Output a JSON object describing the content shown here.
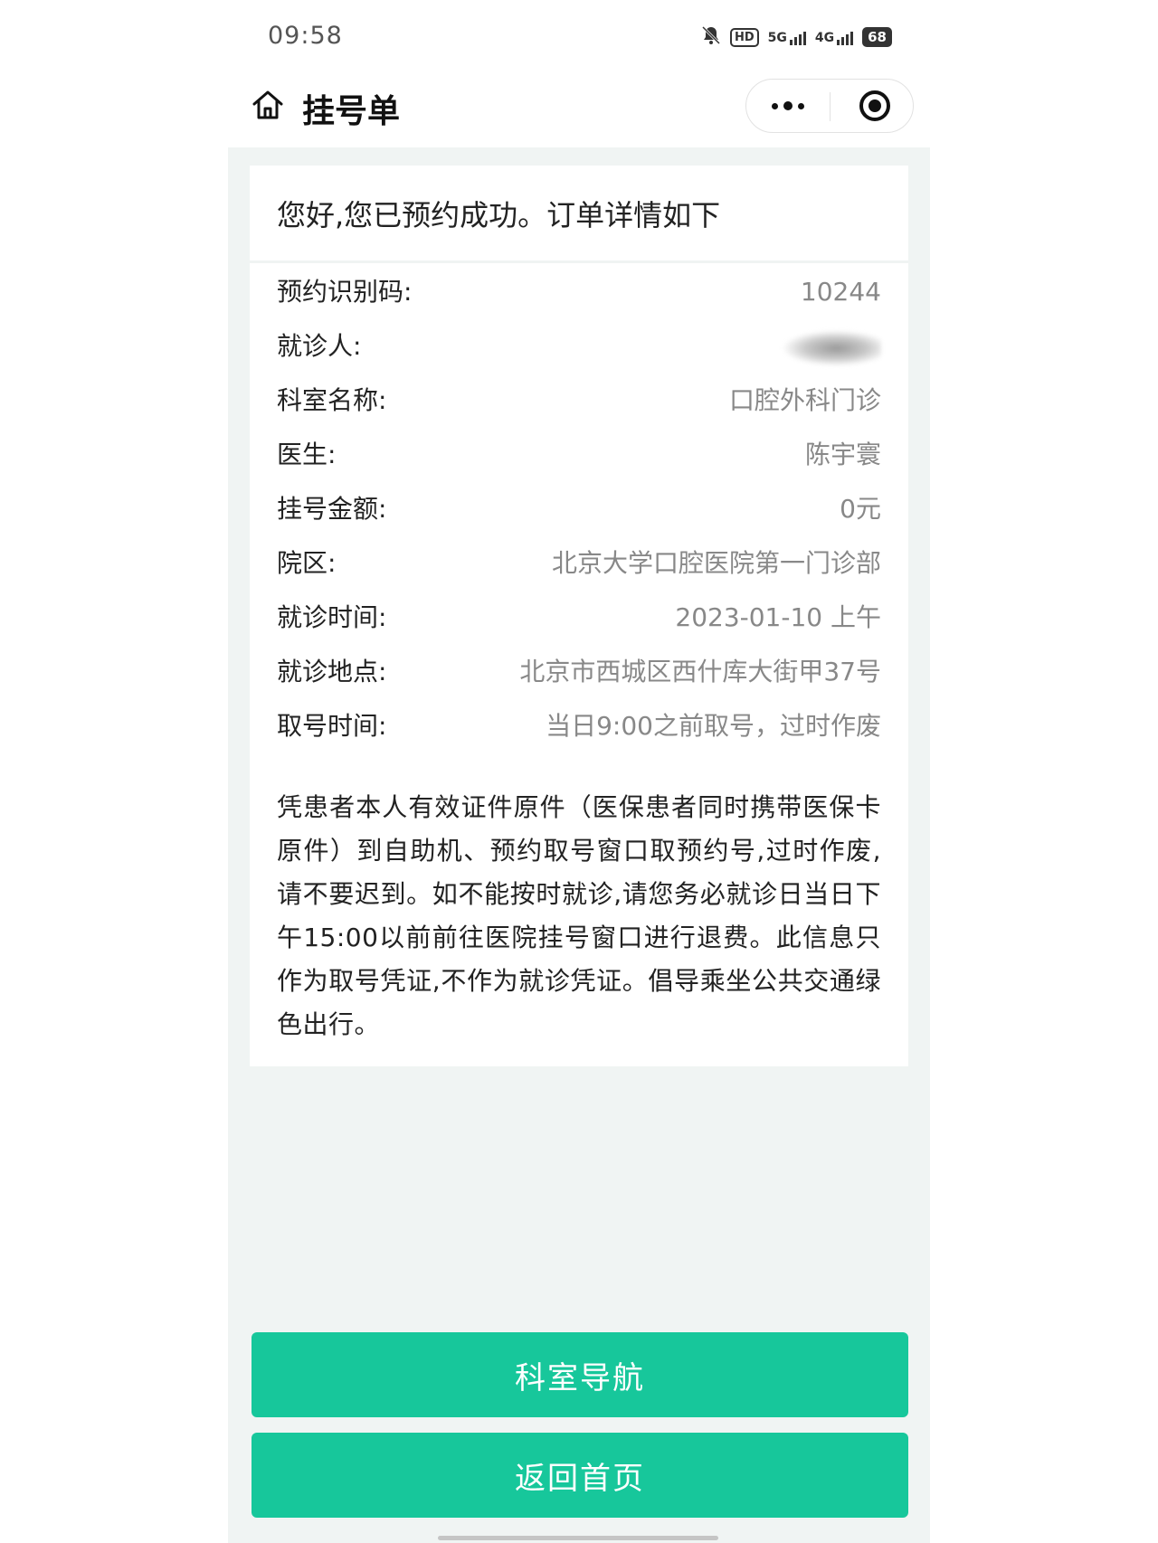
{
  "status_bar": {
    "time": "09:58",
    "hd_label": "HD",
    "net1": "5G",
    "net2": "4G",
    "battery": "68"
  },
  "header": {
    "title": "挂号单",
    "home_icon": "home-icon",
    "more_icon": "more-icon",
    "close_icon": "target-close-icon"
  },
  "card": {
    "greeting": "您好,您已预约成功。订单详情如下",
    "rows": [
      {
        "label": "预约识别码:",
        "value": "10244"
      },
      {
        "label": "就诊人:",
        "value": ""
      },
      {
        "label": "科室名称:",
        "value": "口腔外科门诊"
      },
      {
        "label": "医生:",
        "value": "陈宇寰"
      },
      {
        "label": "挂号金额:",
        "value": "0元"
      },
      {
        "label": "院区:",
        "value": "北京大学口腔医院第一门诊部"
      },
      {
        "label": "就诊时间:",
        "value": "2023-01-10 上午"
      },
      {
        "label": "就诊地点:",
        "value": "北京市西城区西什库大街甲37号"
      },
      {
        "label": "取号时间:",
        "value": "当日9:00之前取号，过时作废"
      }
    ],
    "notice": "凭患者本人有效证件原件（医保患者同时携带医保卡原件）到自助机、预约取号窗口取预约号,过时作废,请不要迟到。如不能按时就诊,请您务必就诊日当日下午15:00以前前往医院挂号窗口进行退费。此信息只作为取号凭证,不作为就诊凭证。倡导乘坐公共交通绿色出行。"
  },
  "buttons": {
    "dept_nav": "科室导航",
    "back_home": "返回首页"
  },
  "colors": {
    "accent": "#17c79b",
    "background": "#f0f4f3"
  }
}
